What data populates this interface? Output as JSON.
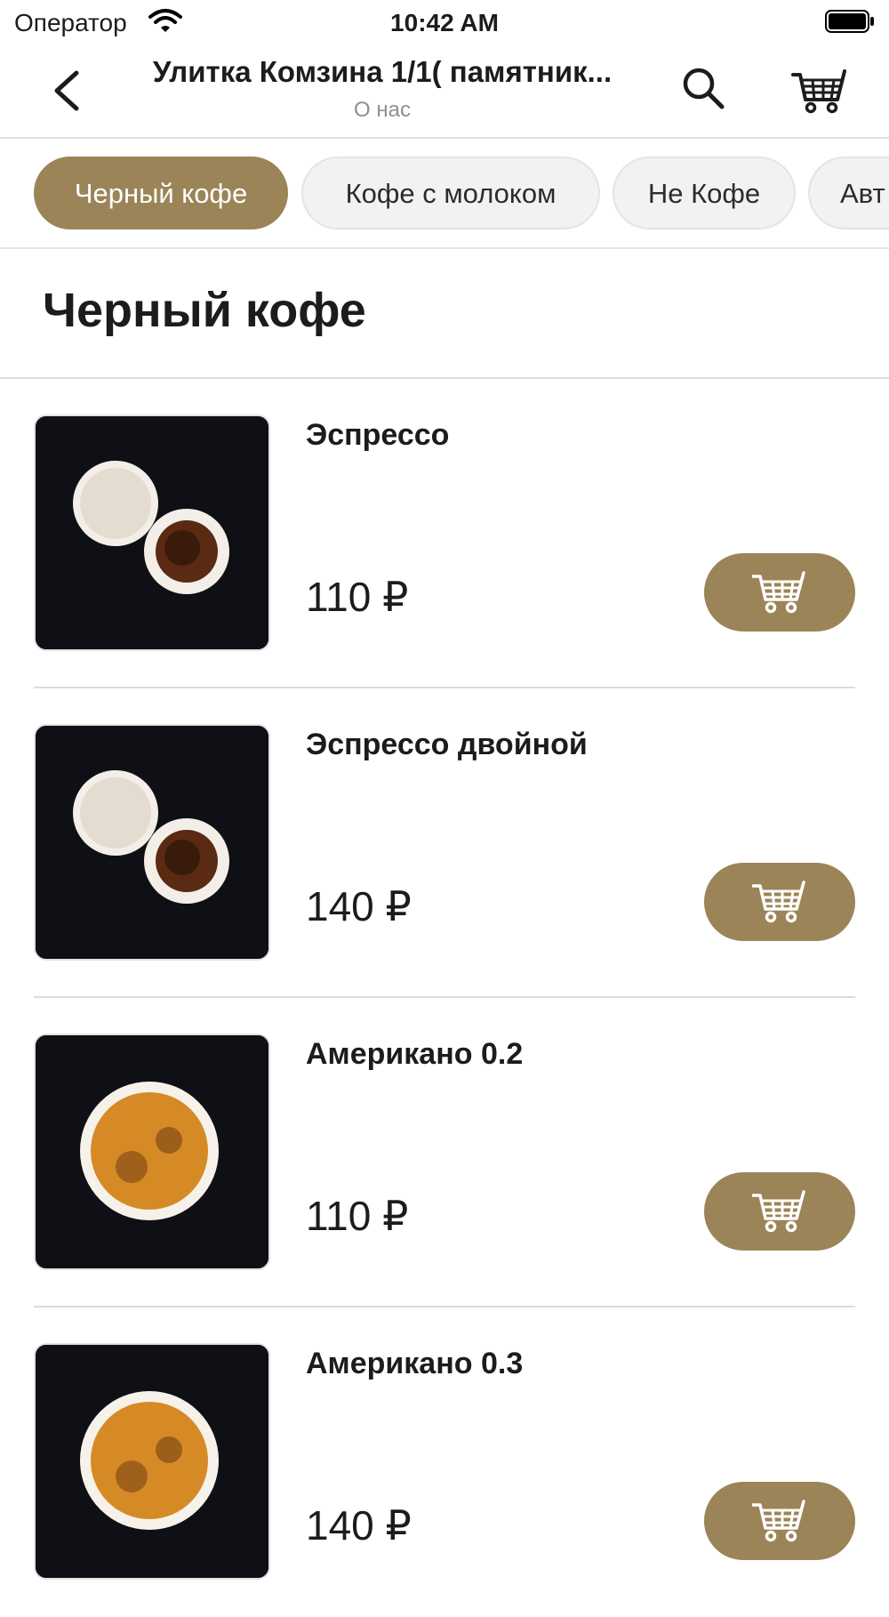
{
  "status_bar": {
    "carrier": "Оператор",
    "time": "10:42 AM",
    "wifi_icon": "wifi-icon",
    "battery_icon": "battery-icon"
  },
  "header": {
    "title": "Улитка  Комзина 1/1( памятник...",
    "subtitle": "О нас",
    "back_icon": "chevron-left-icon",
    "search_icon": "search-icon",
    "cart_icon": "cart-icon"
  },
  "tabs": [
    {
      "label": "Черный кофе",
      "active": true
    },
    {
      "label": "Кофе с молоком",
      "active": false
    },
    {
      "label": "Не Кофе",
      "active": false
    },
    {
      "label": "Авт",
      "active": false
    }
  ],
  "section": {
    "title": "Черный кофе"
  },
  "products": [
    {
      "name": "Эспрессо",
      "price": "110 ₽",
      "image": "espresso-cups"
    },
    {
      "name": "Эспрессо двойной",
      "price": "140 ₽",
      "image": "espresso-cups"
    },
    {
      "name": "Американо 0.2",
      "price": "110 ₽",
      "image": "americano-cup"
    },
    {
      "name": "Американо 0.3",
      "price": "140 ₽",
      "image": "americano-cup"
    }
  ],
  "colors": {
    "accent": "#9b8457",
    "tab_inactive_bg": "#f2f2f2",
    "text": "#1c1c1e",
    "muted": "#8e8e93"
  }
}
